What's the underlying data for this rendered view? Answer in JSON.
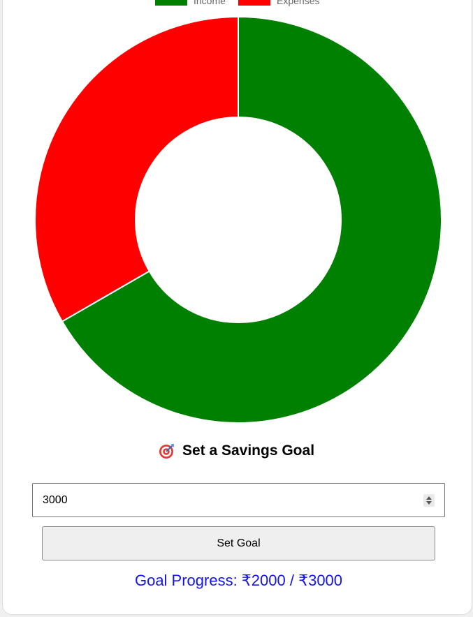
{
  "chart_data": {
    "type": "pie",
    "variant": "doughnut",
    "categories": [
      "Income",
      "Expenses"
    ],
    "values": [
      2000,
      1000
    ],
    "colors": [
      "#008000",
      "#ff0000"
    ],
    "legend_position": "top"
  },
  "savings_goal": {
    "heading": "Set a Savings Goal",
    "heading_icon": "target-icon",
    "input_value": "3000",
    "button_label": "Set Goal",
    "progress_text": "Goal Progress: ₹2000 / ₹3000"
  }
}
